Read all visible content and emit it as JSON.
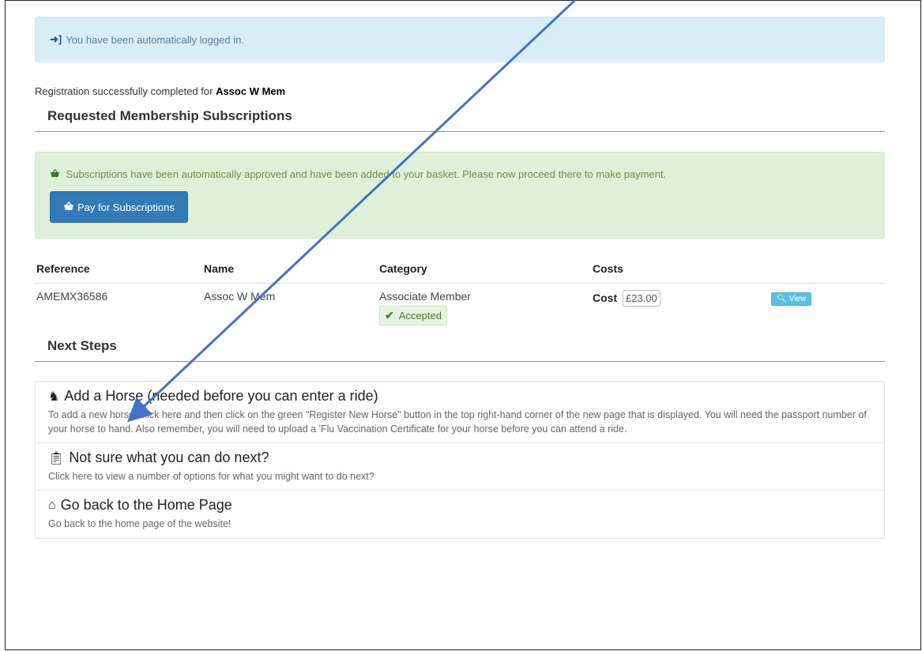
{
  "alert_info": {
    "icon": "sign-in-icon",
    "text": "You have been automatically logged in."
  },
  "registration": {
    "prefix": "Registration successfully completed for",
    "name": "Assoc W Mem"
  },
  "subscriptions_section": {
    "title": "Requested Membership Subscriptions"
  },
  "alert_success": {
    "icon": "basket-icon",
    "text": "Subscriptions have been automatically approved and have been added to your basket. Please now proceed there to make payment.",
    "button_label": "Pay for Subscriptions"
  },
  "table": {
    "headers": [
      "Reference",
      "Name",
      "Category",
      "Costs"
    ],
    "rows": [
      {
        "reference": "AMEMX36586",
        "name": "Assoc W Mem",
        "category": "Associate Member",
        "status": "Accepted",
        "cost_label": "Cost",
        "cost_value": "£23.00",
        "view_label": "View"
      }
    ]
  },
  "next_steps": {
    "title": "Next Steps",
    "items": [
      {
        "icon": "horse-icon",
        "title": "Add a Horse (needed before you can enter a ride)",
        "description": "To add a new horse, click here and then click on the green \"Register New Horse\" button in the top right-hand corner of the new page that is displayed. You will need the passport number of your horse to hand. Also remember, you will need to upload a 'Flu Vaccination Certificate for your horse before you can attend a ride."
      },
      {
        "icon": "clipboard-icon",
        "title": "Not sure what you can do next?",
        "description": "Click here to view a number of options for what you might want to do next?"
      },
      {
        "icon": "home-icon",
        "title": "Go back to the Home Page",
        "description": "Go back to the home page of the website!"
      }
    ]
  },
  "colors": {
    "info_bg": "#d9edf7",
    "success_bg": "#dff0d8",
    "primary_button": "#337ab7",
    "view_button": "#5bc0de",
    "arrow": "#4472c4"
  }
}
